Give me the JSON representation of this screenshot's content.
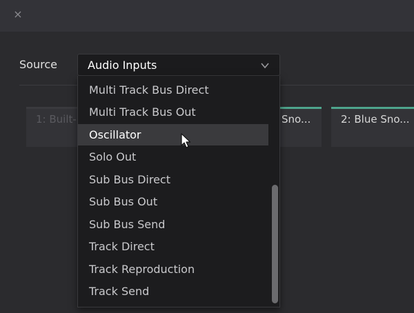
{
  "titlebar": {
    "close_glyph": "×"
  },
  "source": {
    "label": "Source",
    "selected": "Audio Inputs",
    "chevron_icon": "chevron-down-icon"
  },
  "tiles": [
    {
      "label": "1: Built-i...",
      "active": false
    },
    {
      "label": "Sno...",
      "active": true
    },
    {
      "label": "2: Blue Sno...",
      "active": true
    }
  ],
  "dropdown": {
    "options": [
      "Multi Track Bus Direct",
      "Multi Track Bus Out",
      "Oscillator",
      "Solo Out",
      "Sub Bus Direct",
      "Sub Bus Out",
      "Sub Bus Send",
      "Track Direct",
      "Track Reproduction",
      "Track Send"
    ],
    "highlighted": "Oscillator"
  },
  "colors": {
    "accent_tile_bar": "#4ea58d",
    "background": "#2b2b2e",
    "dropdown_bg": "#1c1c1e",
    "highlight_bg": "#3a3a3d"
  }
}
